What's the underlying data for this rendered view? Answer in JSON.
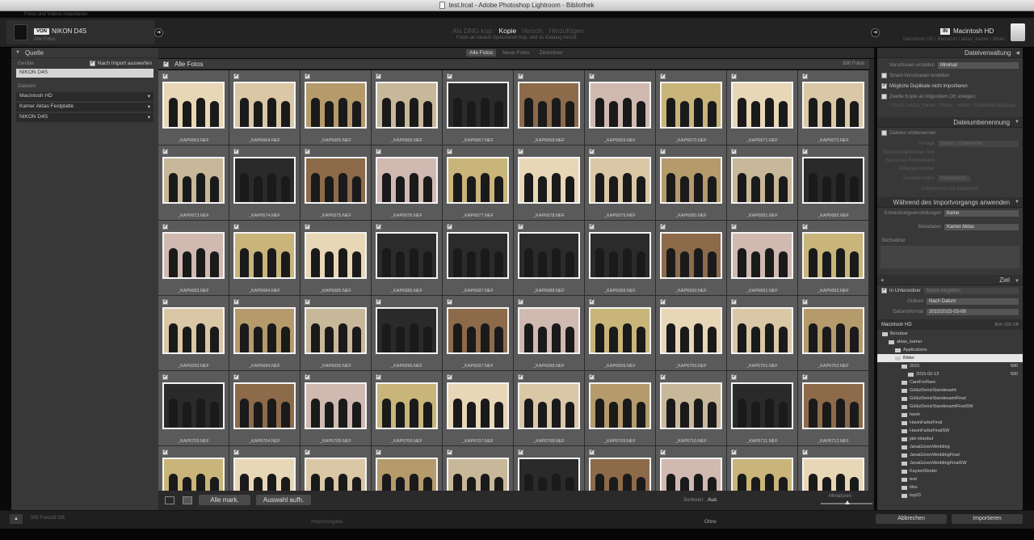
{
  "window": {
    "title": "test.lrcat - Adobe Photoshop Lightroom - Bibliothek",
    "subtitle": "Fotos und Videos importieren"
  },
  "source": {
    "from_badge": "VON",
    "device": "NIKON D4S",
    "device_sub": "Alle Fotos"
  },
  "modes": {
    "tabs": [
      "Als DNG kop.",
      "Kopie",
      "Versch.",
      "Hinzufügen"
    ],
    "active": "Kopie",
    "description": "Fotos an neuem Speicherort kop. und zu Katalog hinzuf."
  },
  "dest": {
    "in_badge": "IN",
    "disk": "Macintosh HD",
    "path": "Macintosh HD / Benutzer / aktas_kamer / Bilder"
  },
  "left_panel": {
    "title": "Quelle",
    "devices_label": "Geräte",
    "eject_label": "Nach Import auswerfen",
    "selected_device": "NIKON D4S",
    "files_label": "Dateien",
    "volumes": [
      "Macintosh HD",
      "Kamer Aktas Festplatte",
      "NIKON D4S"
    ]
  },
  "view_tabs": {
    "items": [
      "Alle Fotos",
      "Neue Fotos",
      "Zielordner"
    ],
    "active": "Alle Fotos"
  },
  "grid": {
    "header": "Alle Fotos",
    "count": "500 Fotos",
    "rows": [
      [
        "_KAP6663.NEF",
        "_KAP6664.NEF",
        "_KAP6665.NEF",
        "_KAP6666.NEF",
        "_KAP6667.NEF",
        "_KAP6668.NEF",
        "_KAP6669.NEF",
        "_KAP6670.NEF",
        "_KAP6671.NEF",
        "_KAP6672.NEF"
      ],
      [
        "_KAP6673.NEF",
        "_KAP6674.NEF",
        "_KAP6675.NEF",
        "_KAP6676.NEF",
        "_KAP6677.NEF",
        "_KAP6678.NEF",
        "_KAP6679.NEF",
        "_KAP6680.NEF",
        "_KAP6681.NEF",
        "_KAP6682.NEF"
      ],
      [
        "_KAP6683.NEF",
        "_KAP6684.NEF",
        "_KAP6685.NEF",
        "_KAP6686.NEF",
        "_KAP6687.NEF",
        "_KAP6688.NEF",
        "_KAP6689.NEF",
        "_KAP6690.NEF",
        "_KAP6691.NEF",
        "_KAP6692.NEF"
      ],
      [
        "_KAP6693.NEF",
        "_KAP6694.NEF",
        "_KAP6695.NEF",
        "_KAP6696.NEF",
        "_KAP6697.NEF",
        "_KAP6698.NEF",
        "_KAP6699.NEF",
        "_KAP6700.NEF",
        "_KAP6701.NEF",
        "_KAP6702.NEF"
      ],
      [
        "_KAP6703.NEF",
        "_KAP6704.NEF",
        "_KAP6705.NEF",
        "_KAP6706.NEF",
        "_KAP6707.NEF",
        "_KAP6708.NEF",
        "_KAP6709.NEF",
        "_KAP6710.NEF",
        "_KAP6711.NEF",
        "_KAP6712.NEF"
      ],
      [
        "",
        "",
        "",
        "",
        "",
        "",
        "",
        "",
        "",
        ""
      ]
    ]
  },
  "bottombar": {
    "check_all": "Alle mark.",
    "uncheck_all": "Auswahl aufh.",
    "sort_label": "Sortieren:",
    "sort_value": "Aus",
    "thumbs_label": "Miniaturen"
  },
  "right_panel": {
    "file_handling": {
      "title": "Dateiverwaltung",
      "previews_label": "Vorschauen erstellen",
      "previews_value": "Minimal",
      "smart_previews": "Smart-Vorschauen erstellen",
      "no_duplicates": "Mögliche Duplikate nicht importieren",
      "second_copy": "Zweite Kopie an folgendem Ort anlegen:",
      "second_copy_path": "/ Users / aktas_kamer / Pictur... mmen / Download Backups"
    },
    "rename": {
      "title": "Dateiumbenennung",
      "rename_files": "Dateien umbenennen",
      "template_label": "Vorlage",
      "template_value": "Datum - Dateiname",
      "custom_text": "Benutzerdefinierter Text",
      "shoot_name": "Name der Fotosession",
      "start_number": "Anfangsnummer",
      "extensions": "Erweiterungen",
      "extensions_value": "Kleinbuchst.",
      "sample": "Unbenennen ist deaktiviert"
    },
    "apply": {
      "title": "Während des Importvorgangs anwenden",
      "dev_label": "Entwicklungseinstellungen",
      "dev_value": "Keine",
      "meta_label": "Metadaten",
      "meta_value": "Kamer Aktas",
      "keywords_label": "Stichwörter"
    },
    "dest": {
      "title": "Ziel",
      "subfolder_label": "In Unterordner",
      "subfolder_placeholder": "Name eingeben",
      "organize_label": "Ordnen",
      "organize_value": "Nach Datum",
      "date_format_label": "Datumsformat",
      "date_format_value": "2015/2015-03-06",
      "disk_name": "Macintosh HD",
      "disk_space": "804 / 931 GB",
      "tree": [
        {
          "name": "Benutzer",
          "depth": 0,
          "count": ""
        },
        {
          "name": "aktas_kamer",
          "depth": 1,
          "count": ""
        },
        {
          "name": "Applications",
          "depth": 2,
          "count": ""
        },
        {
          "name": "Bilder",
          "depth": 2,
          "count": ""
        },
        {
          "name": "2015",
          "depth": 3,
          "count": "500"
        },
        {
          "name": "2015-02-13",
          "depth": 4,
          "count": "500"
        },
        {
          "name": "CareForRare",
          "depth": 3,
          "count": ""
        },
        {
          "name": "GülüzDenizStandesamt",
          "depth": 3,
          "count": ""
        },
        {
          "name": "GülüzDenizStandesamtFinal",
          "depth": 3,
          "count": ""
        },
        {
          "name": "GülüzDenizStandesamtFinalSW",
          "depth": 3,
          "count": ""
        },
        {
          "name": "havin",
          "depth": 3,
          "count": ""
        },
        {
          "name": "HavinFarbeFinal",
          "depth": 3,
          "count": ""
        },
        {
          "name": "HavinFarbeFinalSW",
          "depth": 3,
          "count": ""
        },
        {
          "name": "jale istanbul",
          "depth": 3,
          "count": ""
        },
        {
          "name": "JanaGüvenWedding",
          "depth": 3,
          "count": ""
        },
        {
          "name": "JanaGüvenWeddingFinal",
          "depth": 3,
          "count": ""
        },
        {
          "name": "JanaGüvenWeddingFinalSW",
          "depth": 3,
          "count": ""
        },
        {
          "name": "KayseriKinder",
          "depth": 3,
          "count": ""
        },
        {
          "name": "test",
          "depth": 3,
          "count": ""
        },
        {
          "name": "tilos",
          "depth": 3,
          "count": ""
        },
        {
          "name": "top20",
          "depth": 3,
          "count": ""
        }
      ]
    }
  },
  "footer": {
    "count": "500 Fotos/9 GB",
    "import_preset_label": "Importvorgabe:",
    "import_preset_value": "Ohne",
    "cancel": "Abbrechen",
    "import": "Importieren"
  },
  "colors": {
    "panel": "#383838",
    "grid_cell": "#5a5a5a",
    "accent_white": "#f4f4f4"
  }
}
